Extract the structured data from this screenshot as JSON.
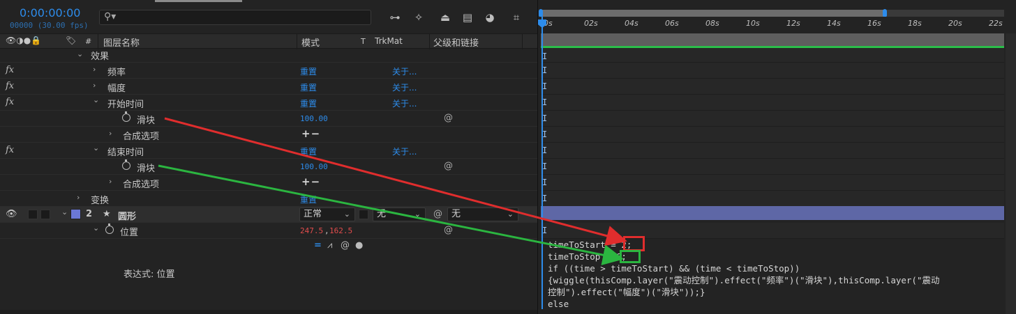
{
  "header": {
    "timecode": "0:00:00:00",
    "fps": "00000 (30.00 fps)",
    "search_icon": "search-icon"
  },
  "columns": {
    "layer_name": "图层名称",
    "mode": "模式",
    "t": "T",
    "trkmat": "TrkMat",
    "parent": "父级和链接",
    "hash": "#"
  },
  "rows": {
    "effects": "效果",
    "frequency": "频率",
    "amplitude": "幅度",
    "start_time": "开始时间",
    "slider1": "滑块",
    "slider1_value": "100.00",
    "composite1": "合成选项",
    "end_time": "结束时间",
    "slider2": "滑块",
    "slider2_value": "100.00",
    "composite2": "合成选项",
    "transform": "变换",
    "reset": "重置",
    "about": "关于...",
    "plusminus": "+−",
    "layer_num": "2",
    "layer_name": "圆形",
    "mode_value": "正常",
    "trkmat_value": "无",
    "parent_value": "无",
    "position": "位置",
    "position_x": "247.5",
    "position_y": "162.5",
    "expression_label": "表达式: 位置"
  },
  "ruler": [
    "0s",
    "02s",
    "04s",
    "06s",
    "08s",
    "10s",
    "12s",
    "14s",
    "16s",
    "18s",
    "20s",
    "22s"
  ],
  "expression": {
    "line1": "timeToStart = 2;",
    "line2": "timeToStop = 6;",
    "line3": "if ((time > timeToStart) && (time < timeToStop))",
    "line4": "{wiggle(thisComp.layer(\"震动控制\").effect(\"频率\")(\"滑块\"),thisComp.layer(\"震动",
    "line5": "控制\").effect(\"幅度\")(\"滑块\"));}",
    "line6": "else"
  },
  "colors": {
    "accent": "#2d8ceb",
    "arrow_red": "#e02d2d",
    "arrow_green": "#2bb540",
    "layer_label": "#6b78d6"
  }
}
